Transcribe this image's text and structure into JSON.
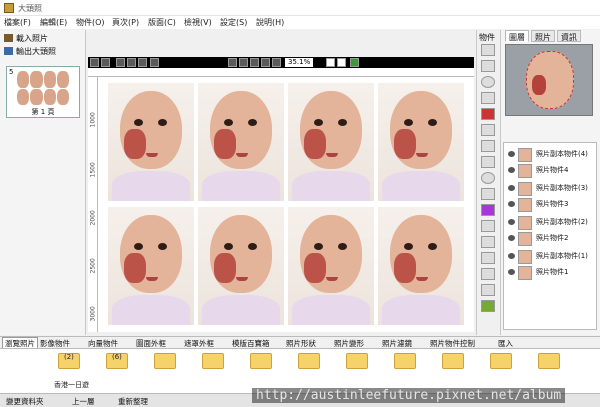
{
  "window": {
    "title": "大頭照"
  },
  "menu": [
    "檔案(F)",
    "編輯(E)",
    "物件(O)",
    "頁次(P)",
    "版面(C)",
    "檢視(V)",
    "設定(S)",
    "說明(H)"
  ],
  "left_panel": {
    "load_photo": "載入照片",
    "export_photo": "輸出大頭照",
    "page_number": "5",
    "page_label": "第 1 頁"
  },
  "canvas_toolbar": {
    "zoom": "35.1%"
  },
  "rulers": {
    "left_labels": [
      "1000",
      "1500",
      "2000",
      "2500",
      "3000"
    ]
  },
  "tool_column": {
    "title": "物件"
  },
  "right_panel": {
    "tabs": [
      "圖層",
      "照片",
      "資訊"
    ],
    "layers": [
      "照片副本物件(4)",
      "照片物件4",
      "照片副本物件(3)",
      "照片物件3",
      "照片副本物件(2)",
      "照片物件2",
      "照片副本物件(1)",
      "照片物件1"
    ]
  },
  "bottom_tabs": [
    "瀏覽照片",
    "影像物件",
    "向量物件",
    "圖面外框",
    "遮罩外框",
    "模版百寶箱",
    "照片形狀",
    "照片變形",
    "照片濾鏡",
    "照片物件控制",
    "匯入"
  ],
  "bottom_strip": {
    "folder_labels": [
      "(2)",
      "(6)",
      "香港一日遊"
    ]
  },
  "status": {
    "left": "變更資料夾",
    "prev": "上一層",
    "refresh": "重新整理"
  },
  "watermark": "http://austinleefuture.pixnet.net/album",
  "colors": {
    "cheek_mark": "#b5423a",
    "skin": "#e3b39a",
    "folder": "#f5d36a"
  }
}
